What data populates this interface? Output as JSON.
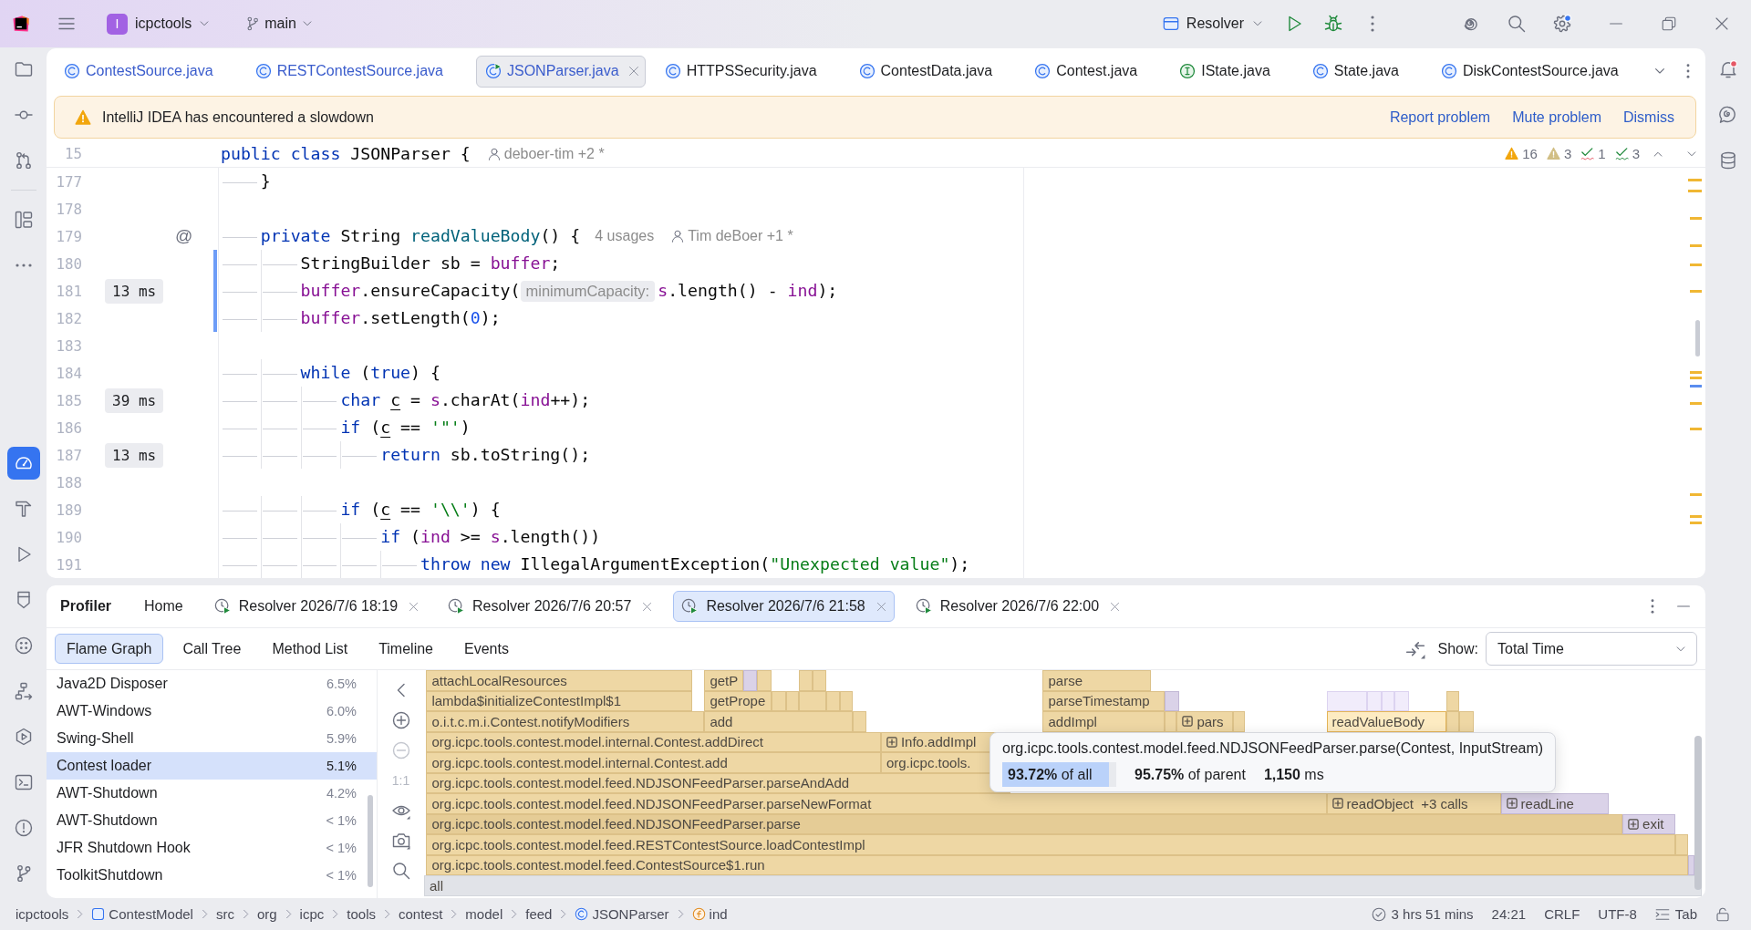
{
  "title_bar": {
    "project_badge": "I",
    "project": "icpctools",
    "branch": "main",
    "run_configuration": "Resolver",
    "settings_badge": true
  },
  "left_toolbar": {
    "top": [
      [
        {
          "kind": "project",
          "selected": false
        },
        {
          "kind": "commit",
          "selected": false
        },
        {
          "kind": "pull-requests",
          "selected": false
        }
      ],
      [
        {
          "kind": "structure",
          "selected": false
        },
        {
          "kind": "more",
          "selected": false
        }
      ]
    ],
    "bottom": [
      {
        "kind": "profiler",
        "selected": true
      },
      {
        "kind": "build",
        "selected": false
      },
      {
        "kind": "run",
        "selected": false
      },
      {
        "kind": "endpoints",
        "selected": false
      },
      {
        "kind": "dependencies",
        "selected": false
      },
      {
        "kind": "hierarchy",
        "selected": false
      },
      {
        "kind": "services",
        "selected": false
      },
      {
        "kind": "terminal",
        "selected": false
      },
      {
        "kind": "problems",
        "selected": false
      },
      {
        "kind": "git",
        "selected": false
      }
    ]
  },
  "right_toolbar": [
    {
      "kind": "notifications",
      "unread": true
    },
    {
      "kind": "ai-chat",
      "unread": false
    },
    {
      "kind": "database",
      "unread": false
    }
  ],
  "editor": {
    "tabs": [
      {
        "label": "ContestSource.java",
        "kind": "class",
        "modified": true,
        "selected": false
      },
      {
        "label": "RESTContestSource.java",
        "kind": "class",
        "modified": true,
        "selected": false
      },
      {
        "label": "JSONParser.java",
        "kind": "runnable-class",
        "modified": true,
        "selected": true
      },
      {
        "label": "HTTPSSecurity.java",
        "kind": "class",
        "modified": false,
        "selected": false
      },
      {
        "label": "ContestData.java",
        "kind": "class",
        "modified": false,
        "selected": false
      },
      {
        "label": "Contest.java",
        "kind": "class",
        "modified": false,
        "selected": false
      },
      {
        "label": "IState.java",
        "kind": "interface",
        "modified": false,
        "selected": false
      },
      {
        "label": "State.java",
        "kind": "class",
        "modified": false,
        "selected": false
      },
      {
        "label": "DiskContestSource.java",
        "kind": "class",
        "modified": false,
        "selected": false
      }
    ],
    "banner": {
      "message": "IntelliJ IDEA has encountered a slowdown",
      "actions": [
        "Report problem",
        "Mute problem",
        "Dismiss"
      ]
    },
    "sticky_line": {
      "number": "15",
      "tokens": [
        {
          "text": "public class",
          "kind": "keyword"
        },
        {
          "text": " JSONParser {",
          "kind": "plain"
        }
      ],
      "author": "deboer-tim +2 *"
    },
    "inspections": [
      {
        "kind": "warning",
        "count": "16"
      },
      {
        "kind": "weak-warning",
        "count": "3"
      },
      {
        "kind": "typo",
        "count": "1"
      },
      {
        "kind": "grammar",
        "count": "3"
      }
    ],
    "lines": [
      {
        "number": "177",
        "changed": false,
        "segments": [
          {
            "kind": "code",
            "tokens": [
              {
                "text": "\t}",
                "kind": "plain"
              }
            ]
          }
        ]
      },
      {
        "number": "178",
        "changed": false
      },
      {
        "number": "179",
        "changed": false,
        "marker": "@",
        "segments": [
          {
            "kind": "code",
            "tokens": [
              {
                "text": "\tprivate",
                "kind": "keyword"
              },
              {
                "text": " String ",
                "kind": "plain"
              },
              {
                "text": "readValueBody",
                "kind": "declaration"
              },
              {
                "text": "() {",
                "kind": "plain"
              }
            ]
          },
          {
            "kind": "usages",
            "text": "4 usages"
          },
          {
            "kind": "author",
            "text": "Tim deBoer +1 *"
          }
        ]
      },
      {
        "number": "180",
        "changed": true,
        "segments": [
          {
            "kind": "code",
            "tokens": [
              {
                "text": "\t\tStringBuilder sb = ",
                "kind": "plain"
              },
              {
                "text": "buffer",
                "kind": "field"
              },
              {
                "text": ";",
                "kind": "plain"
              }
            ]
          }
        ]
      },
      {
        "number": "181",
        "timing": "13 ms",
        "changed": true,
        "segments": [
          {
            "kind": "code",
            "tokens": [
              {
                "text": "\t\tbuffer",
                "kind": "field"
              },
              {
                "text": ".ensureCapacity(",
                "kind": "plain"
              }
            ]
          },
          {
            "kind": "param-hint",
            "text": "minimumCapacity:"
          },
          {
            "kind": "code",
            "tokens": [
              {
                "text": "s",
                "kind": "field"
              },
              {
                "text": ".length() - ",
                "kind": "plain"
              },
              {
                "text": "ind",
                "kind": "field"
              },
              {
                "text": ");",
                "kind": "plain"
              }
            ]
          }
        ]
      },
      {
        "number": "182",
        "changed": true,
        "segments": [
          {
            "kind": "code",
            "tokens": [
              {
                "text": "\t\tbuffer",
                "kind": "field"
              },
              {
                "text": ".setLength(",
                "kind": "plain"
              },
              {
                "text": "0",
                "kind": "number"
              },
              {
                "text": ");",
                "kind": "plain"
              }
            ]
          }
        ]
      },
      {
        "number": "183",
        "changed": false
      },
      {
        "number": "184",
        "changed": false,
        "segments": [
          {
            "kind": "code",
            "tokens": [
              {
                "text": "\t\twhile",
                "kind": "keyword"
              },
              {
                "text": " (",
                "kind": "plain"
              },
              {
                "text": "true",
                "kind": "keyword"
              },
              {
                "text": ") {",
                "kind": "plain"
              }
            ]
          }
        ]
      },
      {
        "number": "185",
        "timing": "39 ms",
        "changed": false,
        "segments": [
          {
            "kind": "code",
            "tokens": [
              {
                "text": "\t\t\tchar ",
                "kind": "keyword"
              },
              {
                "text": "c",
                "kind": "reassigned"
              },
              {
                "text": " = ",
                "kind": "plain"
              },
              {
                "text": "s",
                "kind": "field"
              },
              {
                "text": ".charAt(",
                "kind": "plain"
              },
              {
                "text": "ind",
                "kind": "field"
              },
              {
                "text": "++);",
                "kind": "plain"
              }
            ]
          }
        ]
      },
      {
        "number": "186",
        "changed": false,
        "segments": [
          {
            "kind": "code",
            "tokens": [
              {
                "text": "\t\t\tif",
                "kind": "keyword"
              },
              {
                "text": " (",
                "kind": "plain"
              },
              {
                "text": "c",
                "kind": "reassigned"
              },
              {
                "text": " == ",
                "kind": "plain"
              },
              {
                "text": "'\"'",
                "kind": "string"
              },
              {
                "text": ")",
                "kind": "plain"
              }
            ]
          }
        ]
      },
      {
        "number": "187",
        "timing": "13 ms",
        "changed": false,
        "segments": [
          {
            "kind": "code",
            "tokens": [
              {
                "text": "\t\t\t\treturn",
                "kind": "keyword"
              },
              {
                "text": " sb.toString();",
                "kind": "plain"
              }
            ]
          }
        ]
      },
      {
        "number": "188",
        "changed": false
      },
      {
        "number": "189",
        "changed": false,
        "segments": [
          {
            "kind": "code",
            "tokens": [
              {
                "text": "\t\t\tif",
                "kind": "keyword"
              },
              {
                "text": " (",
                "kind": "plain"
              },
              {
                "text": "c",
                "kind": "reassigned"
              },
              {
                "text": " == ",
                "kind": "plain"
              },
              {
                "text": "'\\\\'",
                "kind": "string"
              },
              {
                "text": ") {",
                "kind": "plain"
              }
            ]
          }
        ]
      },
      {
        "number": "190",
        "changed": false,
        "segments": [
          {
            "kind": "code",
            "tokens": [
              {
                "text": "\t\t\t\tif",
                "kind": "keyword"
              },
              {
                "text": " (",
                "kind": "plain"
              },
              {
                "text": "ind",
                "kind": "field"
              },
              {
                "text": " >= ",
                "kind": "plain"
              },
              {
                "text": "s",
                "kind": "field"
              },
              {
                "text": ".length())",
                "kind": "plain"
              }
            ]
          }
        ]
      },
      {
        "number": "191",
        "changed": false,
        "segments": [
          {
            "kind": "code",
            "tokens": [
              {
                "text": "\t\t\t\t\tthrow new",
                "kind": "keyword"
              },
              {
                "text": " IllegalArgumentException(",
                "kind": "plain"
              },
              {
                "text": "\"Unexpected value\"",
                "kind": "string"
              },
              {
                "text": ");",
                "kind": "plain"
              }
            ]
          }
        ]
      }
    ]
  },
  "profiler": {
    "title": "Profiler",
    "tabs": [
      {
        "label": "Home",
        "kind": "home",
        "selected": false
      },
      {
        "label": "Resolver 2026/7/6 18:19",
        "kind": "snapshot",
        "selected": false
      },
      {
        "label": "Resolver 2026/7/6 20:57",
        "kind": "snapshot",
        "selected": false
      },
      {
        "label": "Resolver 2026/7/6 21:58",
        "kind": "snapshot",
        "selected": true
      },
      {
        "label": "Resolver 2026/7/6 22:00",
        "kind": "snapshot",
        "selected": false
      }
    ],
    "views": [
      {
        "label": "Flame Graph",
        "selected": true
      },
      {
        "label": "Call Tree",
        "selected": false
      },
      {
        "label": "Method List",
        "selected": false
      },
      {
        "label": "Timeline",
        "selected": false
      },
      {
        "label": "Events",
        "selected": false
      }
    ],
    "show": {
      "label": "Show:",
      "value": "Total Time"
    },
    "threads": [
      {
        "name": "Java2D Disposer",
        "share": "6.5%",
        "selected": false
      },
      {
        "name": "AWT-Windows",
        "share": "6.0%",
        "selected": false
      },
      {
        "name": "Swing-Shell",
        "share": "5.9%",
        "selected": false
      },
      {
        "name": "Contest loader",
        "share": "5.1%",
        "selected": true
      },
      {
        "name": "AWT-Shutdown",
        "share": "4.2%",
        "selected": false
      },
      {
        "name": "AWT-Shutdown",
        "share": "< 1%",
        "selected": false
      },
      {
        "name": "JFR Shutdown Hook",
        "share": "< 1%",
        "selected": false
      },
      {
        "name": "ToolkitShutdown",
        "share": "< 1%",
        "selected": false
      }
    ],
    "flame_tools": [
      {
        "kind": "collapse",
        "disabled": false
      },
      {
        "kind": "zoom-in",
        "disabled": false
      },
      {
        "kind": "zoom-out",
        "disabled": true
      },
      {
        "kind": "actual-size",
        "label": "1:1",
        "disabled": true
      },
      {
        "kind": "visibility",
        "disabled": false
      },
      {
        "kind": "screenshot",
        "disabled": false
      },
      {
        "kind": "search",
        "disabled": false
      }
    ],
    "flame_rows": [
      {
        "frames": [
          {
            "label": "attachLocalResources",
            "kind": "project",
            "expandable": false,
            "selected": false
          },
          {
            "label": "getP",
            "kind": "project",
            "expandable": false,
            "selected": false
          },
          {
            "label": "parse",
            "kind": "project",
            "expandable": false,
            "selected": false
          }
        ]
      },
      {
        "frames": [
          {
            "label": "lambda$initializeContestImpl$1",
            "kind": "project",
            "expandable": false,
            "selected": false
          },
          {
            "label": "getPrope",
            "kind": "project",
            "expandable": false,
            "selected": false
          },
          {
            "label": "parseTimestamp",
            "kind": "project",
            "expandable": false,
            "selected": false
          }
        ]
      },
      {
        "frames": [
          {
            "label": "o.i.t.c.m.i.Contest.notifyModifiers",
            "kind": "project",
            "expandable": false,
            "selected": false
          },
          {
            "label": "add",
            "kind": "project",
            "expandable": false,
            "selected": false
          },
          {
            "label": "addImpl",
            "kind": "project",
            "expandable": false,
            "selected": false
          },
          {
            "label": "pars",
            "kind": "project",
            "expandable": true,
            "selected": false
          },
          {
            "label": "readValueBody",
            "kind": "current",
            "expandable": false,
            "selected": false
          }
        ]
      },
      {
        "frames": [
          {
            "label": "org.icpc.tools.contest.model.internal.Contest.addDirect",
            "kind": "project",
            "expandable": false,
            "selected": false
          },
          {
            "label": "Info.addImpl",
            "kind": "project",
            "expandable": true,
            "selected": false
          }
        ]
      },
      {
        "frames": [
          {
            "label": "org.icpc.tools.contest.model.internal.Contest.add",
            "kind": "project",
            "expandable": false,
            "selected": false
          },
          {
            "label": "org.icpc.tools.",
            "kind": "project",
            "expandable": false,
            "selected": false
          }
        ]
      },
      {
        "frames": [
          {
            "label": "org.icpc.tools.contest.model.feed.NDJSONFeedParser.parseAndAdd",
            "kind": "project",
            "expandable": false,
            "selected": false
          }
        ]
      },
      {
        "frames": [
          {
            "label": "org.icpc.tools.contest.model.feed.NDJSONFeedParser.parseNewFormat",
            "kind": "project",
            "expandable": false,
            "selected": false
          },
          {
            "label": "readObject  +3 calls",
            "kind": "project",
            "expandable": true,
            "selected": false
          },
          {
            "label": "readLine",
            "kind": "library",
            "expandable": true,
            "selected": false
          }
        ]
      },
      {
        "frames": [
          {
            "label": "org.icpc.tools.contest.model.feed.NDJSONFeedParser.parse",
            "kind": "project",
            "expandable": false,
            "selected": true
          },
          {
            "label": "exit",
            "kind": "library",
            "expandable": true,
            "selected": false
          }
        ]
      },
      {
        "frames": [
          {
            "label": "org.icpc.tools.contest.model.feed.RESTContestSource.loadContestImpl",
            "kind": "project",
            "expandable": false,
            "selected": false
          }
        ]
      },
      {
        "frames": [
          {
            "label": "org.icpc.tools.contest.model.feed.ContestSource$1.run",
            "kind": "project",
            "expandable": false,
            "selected": false
          }
        ]
      },
      {
        "frames": [
          {
            "label": "all",
            "kind": "root",
            "expandable": false,
            "selected": false
          }
        ]
      }
    ],
    "tooltip": {
      "title": "org.icpc.tools.contest.model.feed.NDJSONFeedParser.parse(Contest, InputStream)",
      "share_of_all": "**93.72%** of all",
      "level": 0.9372,
      "share_of_parent": "**95.75%** of parent",
      "time": "**1,150** ms"
    }
  },
  "status_bar": {
    "breadcrumbs": [
      {
        "label": "icpctools",
        "kind": "project"
      },
      {
        "label": "ContestModel",
        "kind": "module"
      },
      {
        "label": "src",
        "kind": "folder"
      },
      {
        "label": "org",
        "kind": "package"
      },
      {
        "label": "icpc",
        "kind": "package"
      },
      {
        "label": "tools",
        "kind": "package"
      },
      {
        "label": "contest",
        "kind": "package"
      },
      {
        "label": "model",
        "kind": "package"
      },
      {
        "label": "feed",
        "kind": "package"
      },
      {
        "label": "JSONParser",
        "kind": "class"
      },
      {
        "label": "ind",
        "kind": "field"
      }
    ],
    "vcs_time": "3 hrs 51 mins",
    "caret": "24:21",
    "line_separator": "CRLF",
    "encoding": "UTF-8",
    "indent": "Tab",
    "read_only": false
  }
}
